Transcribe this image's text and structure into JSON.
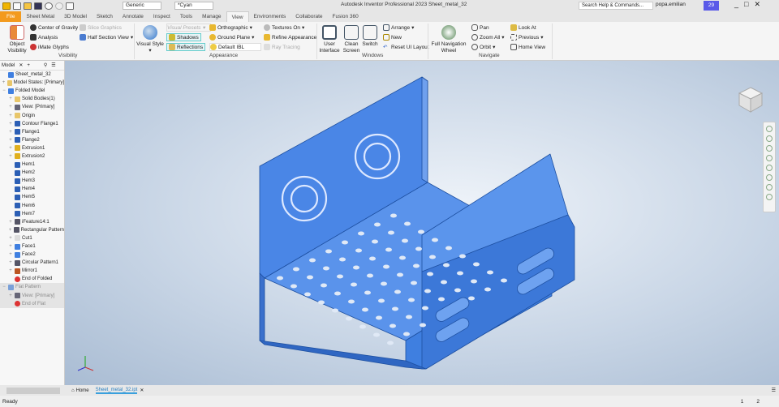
{
  "titlebar": {
    "title": "Autodesk Inventor Professional 2023   Sheet_metal_32",
    "material": "Generic",
    "appearance": "*Cyan",
    "search_placeholder": "Search Help & Commands...",
    "user": "popa.emilian",
    "timer": "29"
  },
  "tabs": [
    "File",
    "Sheet Metal",
    "3D Model",
    "Sketch",
    "Annotate",
    "Inspect",
    "Tools",
    "Manage",
    "View",
    "Environments",
    "Collaborate",
    "Fusion 360"
  ],
  "active_tab": "View",
  "ribbon": {
    "visibility": {
      "label": "Visibility",
      "object_visibility": "Object Visibility",
      "center_of_gravity": "Center of Gravity",
      "analysis": "Analysis",
      "imate_glyphs": "iMate Glyphs",
      "slice_graphics": "Slice Graphics",
      "half_section_view": "Half Section View"
    },
    "appearance": {
      "label": "Appearance",
      "visual_style": "Visual Style",
      "visual_presets": "Visual Presets",
      "shadows": "Shadows",
      "reflections": "Reflections",
      "orthographic": "Orthographic",
      "ground_plane": "Ground Plane",
      "default_ibl": "Default IBL",
      "textures_on": "Textures On",
      "refine_appearance": "Refine Appearance",
      "ray_tracing": "Ray Tracing"
    },
    "windows": {
      "label": "Windows",
      "user_interface": "User Interface",
      "clean_screen": "Clean Screen",
      "switch": "Switch",
      "arrange": "Arrange",
      "new": "New",
      "reset_ui_layout": "Reset UI Layout"
    },
    "navigate": {
      "label": "Navigate",
      "full_navigation_wheel": "Full Navigation Wheel",
      "pan": "Pan",
      "zoom_all": "Zoom All",
      "orbit": "Orbit",
      "look_at": "Look At",
      "previous": "Previous",
      "home_view": "Home View"
    }
  },
  "browser": {
    "tab": "Model",
    "nodes": [
      {
        "label": "Sheet_metal_32",
        "level": 0,
        "icon": "part"
      },
      {
        "label": "Model States: [Primary]",
        "level": 0,
        "icon": "folder",
        "expand": "+"
      },
      {
        "label": "Folded Model",
        "level": 0,
        "icon": "part",
        "expand": "−"
      },
      {
        "label": "Solid Bodies(1)",
        "level": 1,
        "icon": "folder",
        "expand": "+"
      },
      {
        "label": "View: [Primary]",
        "level": 1,
        "icon": "view",
        "expand": "+"
      },
      {
        "label": "Origin",
        "level": 1,
        "icon": "folder",
        "expand": "+"
      },
      {
        "label": "Contour Flange1",
        "level": 1,
        "icon": "feature",
        "expand": "+"
      },
      {
        "label": "Flange1",
        "level": 1,
        "icon": "feature",
        "expand": "+"
      },
      {
        "label": "Flange2",
        "level": 1,
        "icon": "feature",
        "expand": "+"
      },
      {
        "label": "Extrusion1",
        "level": 1,
        "icon": "extrude",
        "expand": "+"
      },
      {
        "label": "Extrusion2",
        "level": 1,
        "icon": "extrude",
        "expand": "+"
      },
      {
        "label": "Hem1",
        "level": 1,
        "icon": "feature"
      },
      {
        "label": "Hem2",
        "level": 1,
        "icon": "feature"
      },
      {
        "label": "Hem3",
        "level": 1,
        "icon": "feature"
      },
      {
        "label": "Hem4",
        "level": 1,
        "icon": "feature"
      },
      {
        "label": "Hem5",
        "level": 1,
        "icon": "feature"
      },
      {
        "label": "Hem6",
        "level": 1,
        "icon": "feature"
      },
      {
        "label": "Hem7",
        "level": 1,
        "icon": "feature"
      },
      {
        "label": "iFeature14:1",
        "level": 1,
        "icon": "ifeature",
        "expand": "+"
      },
      {
        "label": "Rectangular Pattern",
        "level": 1,
        "icon": "pattern",
        "expand": "+"
      },
      {
        "label": "Cut1",
        "level": 1,
        "icon": "cut",
        "expand": "+"
      },
      {
        "label": "Face1",
        "level": 1,
        "icon": "face",
        "expand": "+"
      },
      {
        "label": "Face2",
        "level": 1,
        "icon": "face",
        "expand": "+"
      },
      {
        "label": "Circular Pattern1",
        "level": 1,
        "icon": "pattern",
        "expand": "+"
      },
      {
        "label": "Mirror1",
        "level": 1,
        "icon": "mirror",
        "expand": "+"
      },
      {
        "label": "End of Folded",
        "level": 1,
        "icon": "end"
      },
      {
        "label": "Flat Pattern",
        "level": 0,
        "icon": "flat",
        "expand": "−",
        "grey": true
      },
      {
        "label": "View: [Primary]",
        "level": 1,
        "icon": "view",
        "expand": "+",
        "grey": true
      },
      {
        "label": "End of Flat",
        "level": 1,
        "icon": "end",
        "grey": true
      }
    ]
  },
  "doc_tabs": {
    "home": "Home",
    "active": "Sheet_metal_32.ipt"
  },
  "status": {
    "text": "Ready",
    "page1": "1",
    "page2": "2"
  },
  "colors": {
    "part": "#3f7fe0",
    "file_tab": "#f39a1e",
    "timer": "#5a5ae8"
  }
}
